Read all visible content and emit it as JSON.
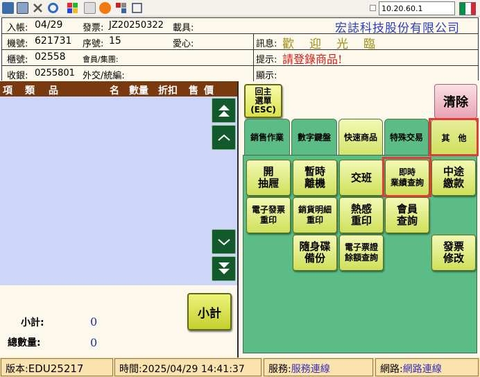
{
  "toolbar": {
    "icons": [
      "app-icon",
      "window-icon",
      "tools-icon",
      "refresh-icon",
      "puzzle-icon",
      "printer-icon",
      "alert-icon",
      "network-icon",
      "fullscreen-icon"
    ],
    "ip": "10.20.60.1"
  },
  "info": {
    "row1": {
      "ledger_label": "入帳:",
      "ledger_value": "04/29",
      "invoice_label": "發票:",
      "invoice_value": "JZ20250322",
      "member_label": "載具:",
      "company": "宏誌科技股份有限公司"
    },
    "row2": {
      "machine_label": "機號:",
      "machine_value": "621731",
      "seq_label": "序號:",
      "seq_value": "15",
      "love_label": "愛心:",
      "msg_label": "訊息:",
      "msg_value": "歡迎光臨"
    },
    "row3": {
      "counter_label": "櫃號:",
      "counter_value": "02558",
      "member_label": "會員/集團:",
      "hint_label": "提示:",
      "hint_value": "請登錄商品!"
    },
    "row4": {
      "cashier_label": "收銀:",
      "cashier_value": "0255801",
      "tax_label": "外交/統編:",
      "display_label": "顯示:"
    }
  },
  "list_header": {
    "item": "項",
    "category": "類",
    "goods": "品",
    "name": "名",
    "qty": "數量",
    "discount": "折扣",
    "price": "售價"
  },
  "totals": {
    "subtotal_label": "小計:",
    "subtotal_value": "0",
    "qty_label": "總數量:",
    "qty_value": "0",
    "subtotal_button": "小計"
  },
  "buttons": {
    "back": "回主\n選單\n(ESC)",
    "clear": "清除"
  },
  "tabs": [
    {
      "label": "銷售作業"
    },
    {
      "label": "數字鍵盤"
    },
    {
      "label": "快速商品"
    },
    {
      "label": "特殊交易"
    },
    {
      "label": "其　他"
    }
  ],
  "functions": [
    {
      "label": "開\n抽屜"
    },
    {
      "label": "暫時\n離機"
    },
    {
      "label": "交班"
    },
    {
      "label": "即時\n業績查詢"
    },
    {
      "label": "中途\n繳款"
    },
    {
      "label": "電子發票\n重印"
    },
    {
      "label": "銷貨明細\n重印"
    },
    {
      "label": "熱感\n重印"
    },
    {
      "label": "會員\n查詢"
    },
    {
      "label": "隨身碟\n備份"
    },
    {
      "label": "電子票證\n餘額查詢"
    },
    {
      "label": "發票\n修改"
    }
  ],
  "status": {
    "version_label": "版本:",
    "version_value": "EDU25217",
    "time_label": "時間:",
    "time_value": "2025/04/29 14:41:37",
    "service_label": "服務:",
    "service_value": "服務連線",
    "network_label": "網路:",
    "network_value": "網路連線"
  },
  "colors": {
    "accent_green": "#5cbc86",
    "list_bg": "#cdd6f6",
    "header_brown": "#7a3a10",
    "highlight": "#e03a3a"
  }
}
